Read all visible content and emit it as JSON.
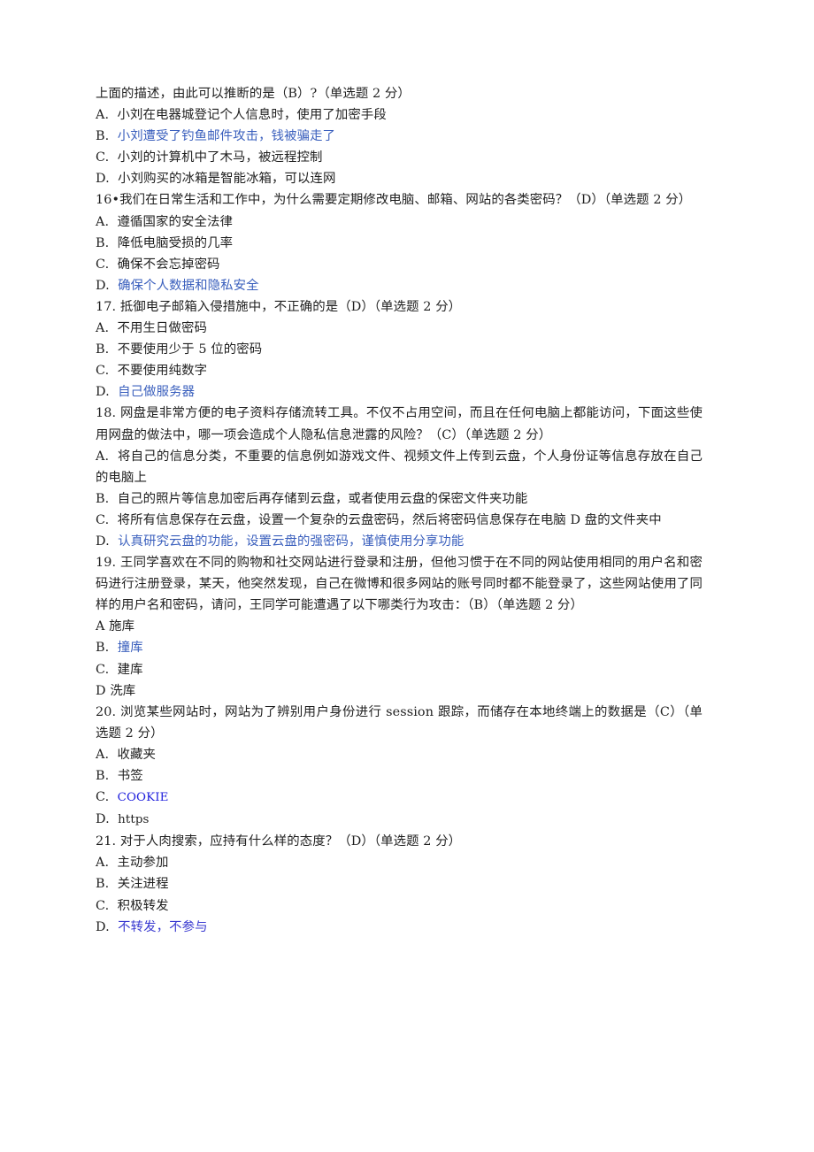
{
  "document": {
    "type": "exam-answer-sheet",
    "language": "zh-CN",
    "highlight_color": "#3a5fbd",
    "latin_highlight_color": "#2222dd",
    "text_color": "#1f1f1f",
    "background_color": "#ffffff"
  },
  "blocks": [
    {
      "id": "q15-stem-tail",
      "kind": "stem",
      "text": "上面的描述，由此可以推断的是（B）?（单选题 2 分）"
    },
    {
      "id": "q15-a",
      "kind": "option",
      "letter": "A.",
      "text": "小刘在电器城登记个人信息时，使用了加密手段",
      "highlight": false
    },
    {
      "id": "q15-b",
      "kind": "option",
      "letter": "B.",
      "text": "小刘遭受了钓鱼邮件攻击，钱被骗走了",
      "highlight": true
    },
    {
      "id": "q15-c",
      "kind": "option",
      "letter": "C.",
      "text": "小刘的计算机中了木马，被远程控制",
      "highlight": false
    },
    {
      "id": "q15-d",
      "kind": "option",
      "letter": "D.",
      "text": "小刘购买的冰箱是智能冰箱，可以连网",
      "highlight": false
    },
    {
      "id": "q16-stem",
      "kind": "stem",
      "text": "16•我们在日常生活和工作中，为什么需要定期修改电脑、邮箱、网站的各类密码？（D）（单选题 2 分）"
    },
    {
      "id": "q16-a",
      "kind": "option",
      "letter": "A.",
      "text": "遵循国家的安全法律",
      "highlight": false
    },
    {
      "id": "q16-b",
      "kind": "option",
      "letter": "B.",
      "text": "降低电脑受损的几率",
      "highlight": false
    },
    {
      "id": "q16-c",
      "kind": "option",
      "letter": "C.",
      "text": "确保不会忘掉密码",
      "highlight": false
    },
    {
      "id": "q16-d",
      "kind": "option",
      "letter": "D.",
      "text": "确保个人数据和隐私安全",
      "highlight": true
    },
    {
      "id": "q17-stem",
      "kind": "stem",
      "text": "17. 抵御电子邮箱入侵措施中，不正确的是（D）（单选题 2 分）"
    },
    {
      "id": "q17-a",
      "kind": "option",
      "letter": "A.",
      "text": "不用生日做密码",
      "highlight": false
    },
    {
      "id": "q17-b",
      "kind": "option",
      "letter": "B.",
      "text": "不要使用少于 5 位的密码",
      "highlight": false
    },
    {
      "id": "q17-c",
      "kind": "option",
      "letter": "C.",
      "text": "不要使用纯数字",
      "highlight": false
    },
    {
      "id": "q17-d",
      "kind": "option",
      "letter": "D.",
      "text": "自己做服务器",
      "highlight": true
    },
    {
      "id": "q18-stem",
      "kind": "stem",
      "text": "18. 网盘是非常方便的电子资料存储流转工具。不仅不占用空间，而且在任何电脑上都能访问，下面这些使用网盘的做法中，哪一项会造成个人隐私信息泄露的风险？（C）（单选题 2 分）"
    },
    {
      "id": "q18-a",
      "kind": "option",
      "letter": "A.",
      "text": "将自己的信息分类，不重要的信息例如游戏文件、视频文件上传到云盘，个人身份证等信息存放在自己的电脑上",
      "highlight": false
    },
    {
      "id": "q18-b",
      "kind": "option",
      "letter": "B.",
      "text": "自己的照片等信息加密后再存储到云盘，或者使用云盘的保密文件夹功能",
      "highlight": false
    },
    {
      "id": "q18-c",
      "kind": "option",
      "letter": "C.",
      "text": "将所有信息保存在云盘，设置一个复杂的云盘密码，然后将密码信息保存在电脑 D 盘的文件夹中",
      "highlight": false
    },
    {
      "id": "q18-d",
      "kind": "option",
      "letter": "D.",
      "text": "认真研究云盘的功能，设置云盘的强密码，谨慎使用分享功能",
      "highlight": true
    },
    {
      "id": "q19-stem",
      "kind": "stem",
      "text": "19. 王同学喜欢在不同的购物和社交网站进行登录和注册，但他习惯于在不同的网站使用相同的用户名和密码进行注册登录，某天，他突然发现，自己在微博和很多网站的账号同时都不能登录了，这些网站使用了同样的用户名和密码，请问，王同学可能遭遇了以下哪类行为攻击：（B）（单选题 2 分）"
    },
    {
      "id": "q19-a",
      "kind": "option",
      "letter": "A",
      "text": "施库",
      "highlight": false,
      "no_space_after_letter": true
    },
    {
      "id": "q19-b",
      "kind": "option",
      "letter": "B.",
      "text": "撞库",
      "highlight": true
    },
    {
      "id": "q19-c",
      "kind": "option",
      "letter": "C.",
      "text": "建库",
      "highlight": false
    },
    {
      "id": "q19-d",
      "kind": "option",
      "letter": "D",
      "text": "洗库",
      "highlight": false,
      "no_space_after_letter": true
    },
    {
      "id": "q20-stem",
      "kind": "stem",
      "text": "20. 浏览某些网站时，网站为了辨别用户身份进行 session 跟踪，而储存在本地终端上的数据是（C）（单选题 2 分）"
    },
    {
      "id": "q20-a",
      "kind": "option",
      "letter": "A.",
      "text": "收藏夹",
      "highlight": false
    },
    {
      "id": "q20-b",
      "kind": "option",
      "letter": "B.",
      "text": "书签",
      "highlight": false
    },
    {
      "id": "q20-c",
      "kind": "option",
      "letter": "C.",
      "text": "COOKIE",
      "highlight": true,
      "latin": true
    },
    {
      "id": "q20-d",
      "kind": "option",
      "letter": "D.",
      "text": "https",
      "highlight": false,
      "latin": true
    },
    {
      "id": "q21-stem",
      "kind": "stem",
      "text": "21. 对于人肉搜索，应持有什么样的态度？（D）（单选题 2 分）"
    },
    {
      "id": "q21-a",
      "kind": "option",
      "letter": "A.",
      "text": "主动参加",
      "highlight": false
    },
    {
      "id": "q21-b",
      "kind": "option",
      "letter": "B.",
      "text": "关注进程",
      "highlight": false
    },
    {
      "id": "q21-c",
      "kind": "option",
      "letter": "C.",
      "text": "积极转发",
      "highlight": false
    },
    {
      "id": "q21-d",
      "kind": "option",
      "letter": "D.",
      "text": "不转发，不参与",
      "highlight": true,
      "violet": true
    }
  ]
}
